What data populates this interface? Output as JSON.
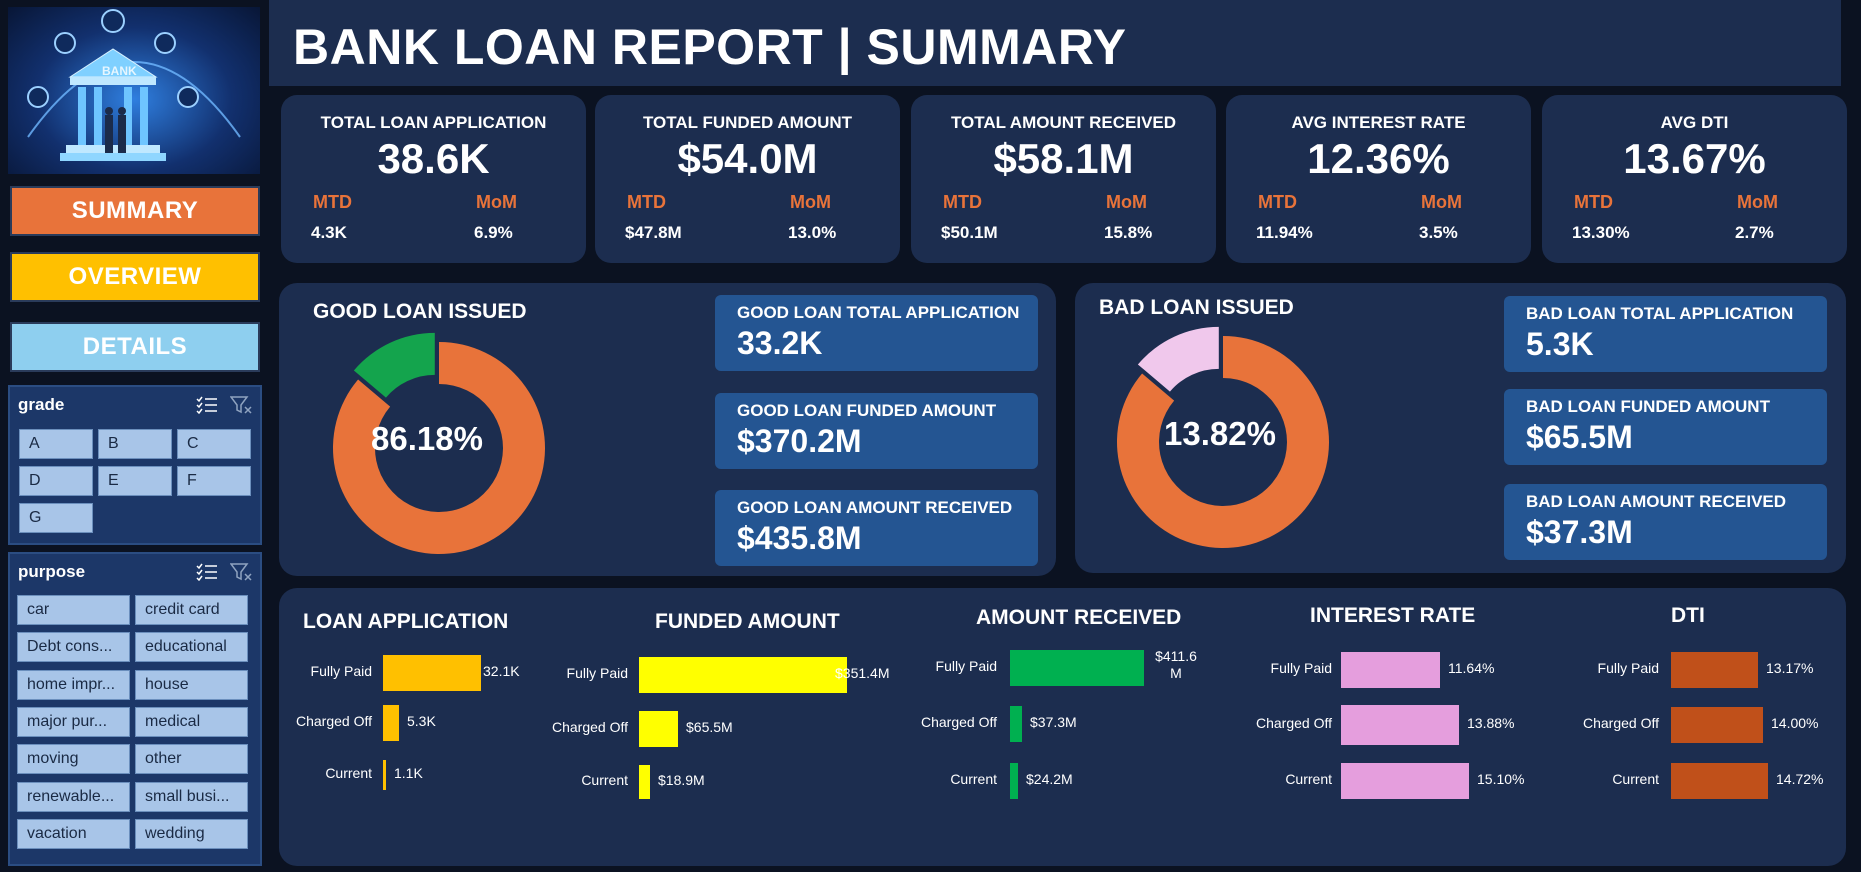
{
  "report_title": "BANK LOAN REPORT | SUMMARY",
  "logo_text": "BANK",
  "nav": {
    "summary": "SUMMARY",
    "overview": "OVERVIEW",
    "details": "DETAILS"
  },
  "colors": {
    "summary": "#e8733a",
    "overview": "#ffc000",
    "details": "#8ecfef",
    "orange": "#e8733a",
    "green": "#14a44d",
    "pink": "#f0c8ec"
  },
  "slicers": {
    "grade": {
      "title": "grade",
      "items": [
        "A",
        "B",
        "C",
        "D",
        "E",
        "F",
        "G"
      ]
    },
    "purpose": {
      "title": "purpose",
      "items": [
        "car",
        "credit card",
        "Debt cons...",
        "educational",
        "home impr...",
        "house",
        "major pur...",
        "medical",
        "moving",
        "other",
        "renewable...",
        "small busi...",
        "vacation",
        "wedding"
      ]
    }
  },
  "kpis": [
    {
      "label": "TOTAL LOAN APPLICATION",
      "value": "38.6K",
      "mtd_label": "MTD",
      "mtd": "4.3K",
      "mom_label": "MoM",
      "mom": "6.9%"
    },
    {
      "label": "TOTAL FUNDED AMOUNT",
      "value": "$54.0M",
      "mtd_label": "MTD",
      "mtd": "$47.8M",
      "mom_label": "MoM",
      "mom": "13.0%"
    },
    {
      "label": "TOTAL AMOUNT RECEIVED",
      "value": "$58.1M",
      "mtd_label": "MTD",
      "mtd": "$50.1M",
      "mom_label": "MoM",
      "mom": "15.8%"
    },
    {
      "label": "AVG INTEREST RATE",
      "value": "12.36%",
      "mtd_label": "MTD",
      "mtd": "11.94%",
      "mom_label": "MoM",
      "mom": "3.5%"
    },
    {
      "label": "AVG DTI",
      "value": "13.67%",
      "mtd_label": "MTD",
      "mtd": "13.30%",
      "mom_label": "MoM",
      "mom": "2.7%"
    }
  ],
  "good_loan": {
    "title": "GOOD LOAN ISSUED",
    "pct_label": "86.18%",
    "pct": 86.18,
    "cards": [
      {
        "label": "GOOD LOAN TOTAL APPLICATION",
        "value": "33.2K"
      },
      {
        "label": "GOOD LOAN FUNDED AMOUNT",
        "value": "$370.2M"
      },
      {
        "label": "GOOD LOAN AMOUNT RECEIVED",
        "value": "$435.8M"
      }
    ]
  },
  "bad_loan": {
    "title": "BAD LOAN ISSUED",
    "pct_label": "13.82%",
    "pct": 13.82,
    "cards": [
      {
        "label": "BAD LOAN TOTAL APPLICATION",
        "value": "5.3K"
      },
      {
        "label": "BAD LOAN FUNDED AMOUNT",
        "value": "$65.5M"
      },
      {
        "label": "BAD LOAN AMOUNT RECEIVED",
        "value": "$37.3M"
      }
    ]
  },
  "chart_data": [
    {
      "type": "bar",
      "title": "LOAN APPLICATION",
      "categories": [
        "Fully Paid",
        "Charged Off",
        "Current"
      ],
      "values": [
        32.1,
        5.3,
        1.1
      ],
      "labels": [
        "32.1K",
        "5.3K",
        "1.1K"
      ],
      "color": "#ffc000",
      "max": 32.1
    },
    {
      "type": "bar",
      "title": "FUNDED AMOUNT",
      "categories": [
        "Fully Paid",
        "Charged Off",
        "Current"
      ],
      "values": [
        351.4,
        65.5,
        18.9
      ],
      "labels": [
        "$351.4M",
        "$65.5M",
        "$18.9M"
      ],
      "color": "#ffff00",
      "max": 351.4
    },
    {
      "type": "bar",
      "title": "AMOUNT RECEIVED",
      "categories": [
        "Fully Paid",
        "Charged Off",
        "Current"
      ],
      "values": [
        411.6,
        37.3,
        24.2
      ],
      "labels": [
        "$411.6 M",
        "$37.3M",
        "$24.2M"
      ],
      "color": "#00b050",
      "max": 411.6
    },
    {
      "type": "bar",
      "title": "INTEREST RATE",
      "categories": [
        "Fully Paid",
        "Charged Off",
        "Current"
      ],
      "values": [
        11.64,
        13.88,
        15.1
      ],
      "labels": [
        "11.64%",
        "13.88%",
        "15.10%"
      ],
      "color": "#e59edd",
      "max": 15.1
    },
    {
      "type": "bar",
      "title": "DTI",
      "categories": [
        "Fully Paid",
        "Charged Off",
        "Current"
      ],
      "values": [
        13.17,
        14.0,
        14.72
      ],
      "labels": [
        "13.17%",
        "14.00%",
        "14.72%"
      ],
      "color": "#c0501a",
      "max": 14.72
    }
  ]
}
